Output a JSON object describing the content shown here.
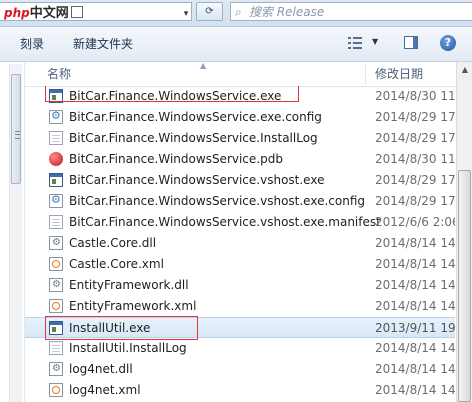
{
  "address": {
    "logo_php": "php",
    "logo_zh": "中文网",
    "dropdown": "▾"
  },
  "search": {
    "placeholder": "搜索 Release",
    "icon": "search-icon"
  },
  "toolbar": {
    "burn_label": "刻录",
    "new_folder_label": "新建文件夹",
    "help_label": "?"
  },
  "columns": {
    "name": "名称",
    "date_modified": "修改日期"
  },
  "files": [
    {
      "name": "BitCar.Finance.WindowsService.exe",
      "date": "2014/8/30 11",
      "icon": "exe-icon",
      "highlighted": true
    },
    {
      "name": "BitCar.Finance.WindowsService.exe.config",
      "date": "2014/8/29 17",
      "icon": "config-icon"
    },
    {
      "name": "BitCar.Finance.WindowsService.InstallLog",
      "date": "2014/8/29 17",
      "icon": "document-icon"
    },
    {
      "name": "BitCar.Finance.WindowsService.pdb",
      "date": "2014/8/30 11",
      "icon": "pdb-icon"
    },
    {
      "name": "BitCar.Finance.WindowsService.vshost.exe",
      "date": "2014/8/29 17",
      "icon": "exe-icon"
    },
    {
      "name": "BitCar.Finance.WindowsService.vshost.exe.config",
      "date": "2014/8/29 17",
      "icon": "config-icon"
    },
    {
      "name": "BitCar.Finance.WindowsService.vshost.exe.manifest",
      "date": "2012/6/6 2:06",
      "icon": "document-icon"
    },
    {
      "name": "Castle.Core.dll",
      "date": "2014/8/14 14",
      "icon": "dll-icon"
    },
    {
      "name": "Castle.Core.xml",
      "date": "2014/8/14 14",
      "icon": "xml-icon"
    },
    {
      "name": "EntityFramework.dll",
      "date": "2014/8/14 14",
      "icon": "dll-icon"
    },
    {
      "name": "EntityFramework.xml",
      "date": "2014/8/14 14",
      "icon": "xml-icon"
    },
    {
      "name": "InstallUtil.exe",
      "date": "2013/9/11 19",
      "icon": "exe-icon",
      "highlighted": true,
      "selected": true
    },
    {
      "name": "InstallUtil.InstallLog",
      "date": "2014/8/14 14",
      "icon": "document-icon"
    },
    {
      "name": "log4net.dll",
      "date": "2014/8/14 14",
      "icon": "dll-icon"
    },
    {
      "name": "log4net.xml",
      "date": "2014/8/14 14",
      "icon": "xml-icon"
    }
  ],
  "colors": {
    "highlight_box": "#d83a3a",
    "selection": "#d8e7f8"
  }
}
